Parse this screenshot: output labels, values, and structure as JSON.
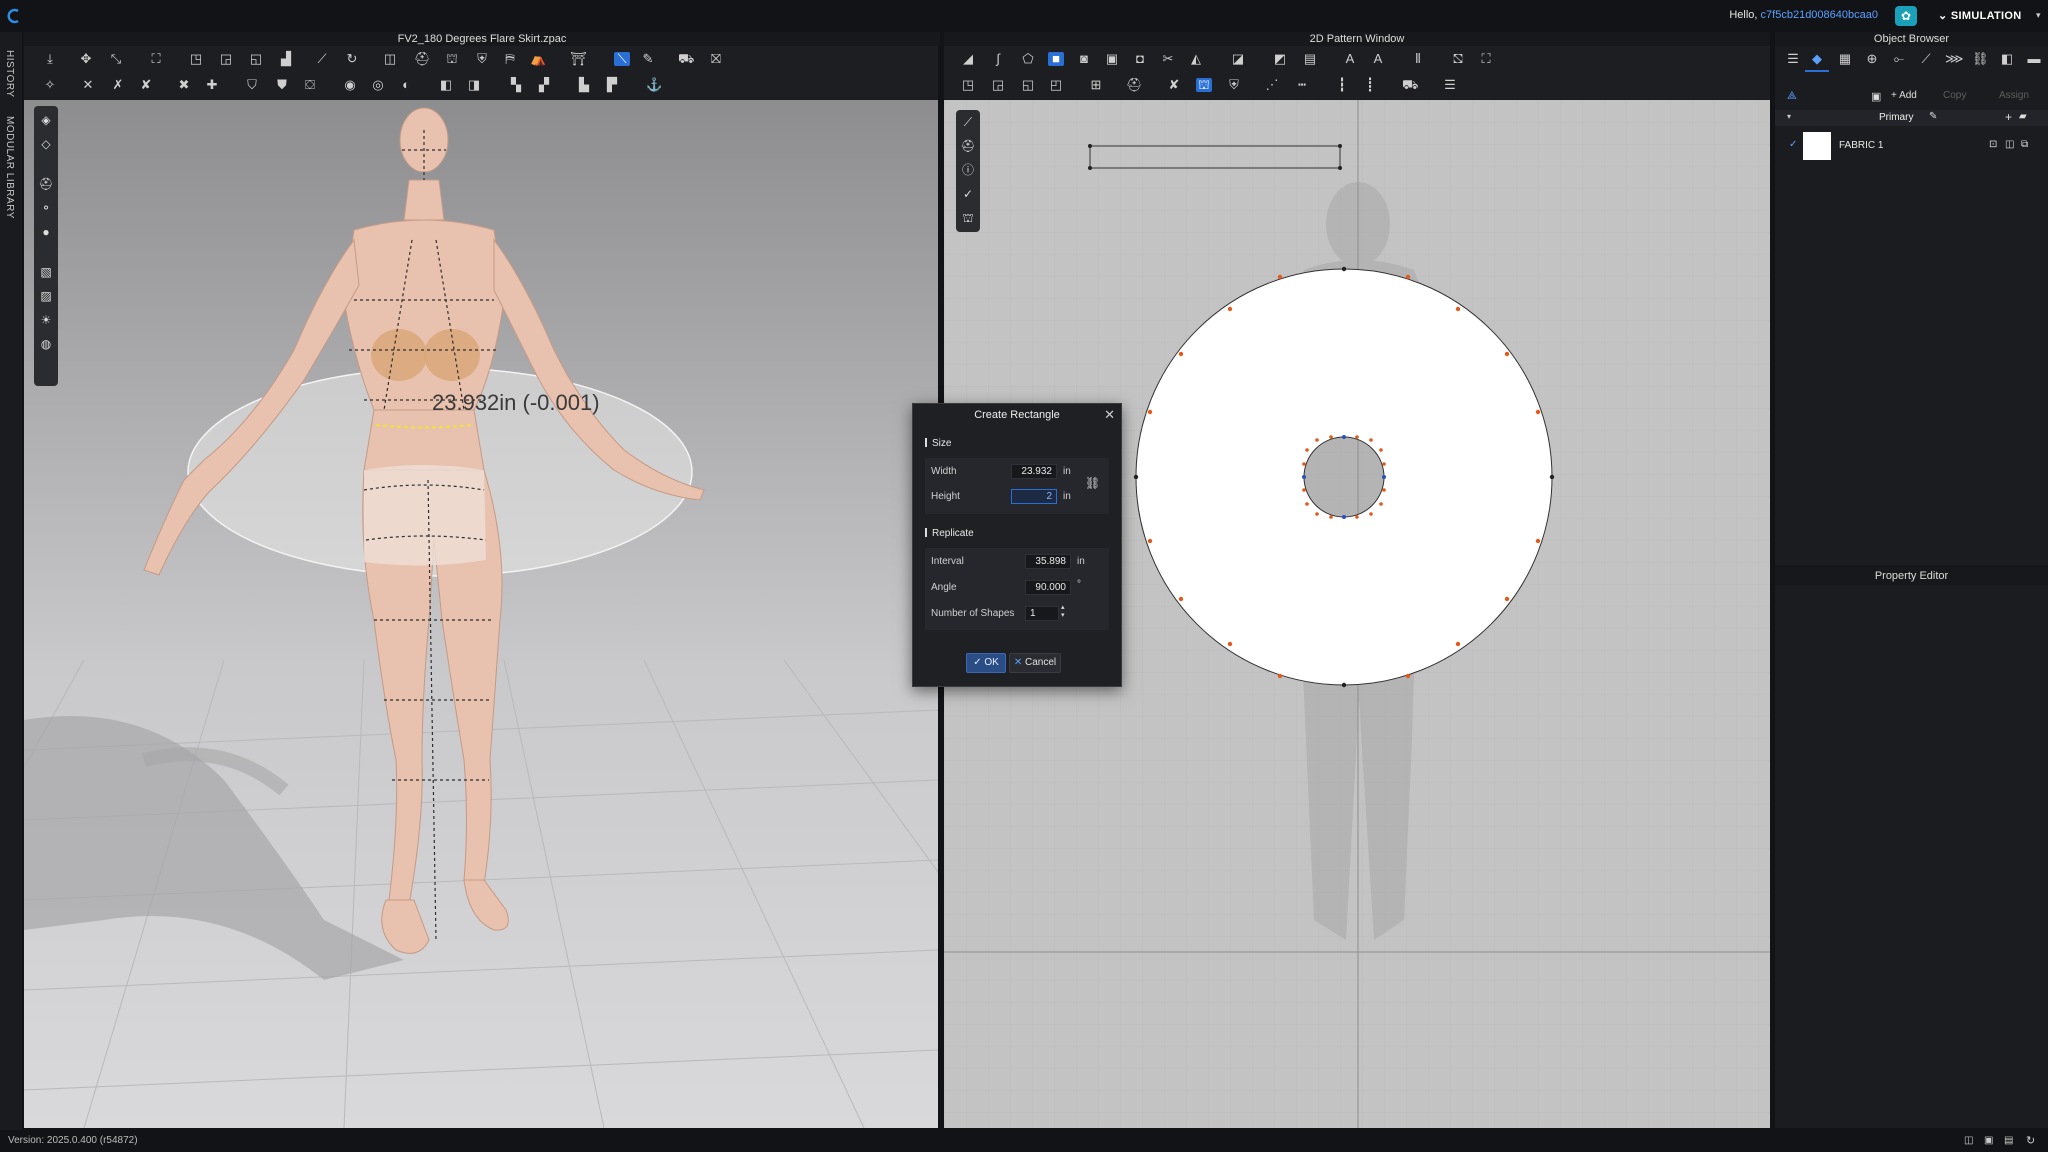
{
  "user": {
    "greeting": "Hello, ",
    "id": "c7f5cb21d008640bcaa0"
  },
  "mode": {
    "label": "SIMULATION"
  },
  "side_tabs": [
    "HISTORY",
    "MODULAR LIBRARY"
  ],
  "window_3d": {
    "title": "FV2_180 Degrees Flare Skirt.zpac",
    "measurement": "23.932in (-0.001)"
  },
  "window_2d": {
    "title": "2D Pattern Window"
  },
  "object_browser": {
    "title": "Object Browser",
    "add_label": "+ Add",
    "copy_label": "Copy",
    "assign_label": "Assign",
    "colorway": "Primary",
    "fabric_item": {
      "name": "FABRIC 1",
      "swatch_color": "#ffffff"
    }
  },
  "property_editor": {
    "title": "Property Editor"
  },
  "dialog": {
    "title": "Create Rectangle",
    "size_section": "Size",
    "width_label": "Width",
    "width_value": "23.932",
    "width_unit": "in",
    "height_label": "Height",
    "height_value": "2",
    "height_unit": "in",
    "replicate_section": "Replicate",
    "interval_label": "Interval",
    "interval_value": "35.898",
    "interval_unit": "in",
    "angle_label": "Angle",
    "angle_value": "90.000",
    "angle_unit": "°",
    "shapes_label": "Number of Shapes",
    "shapes_value": "1",
    "ok_label": "OK",
    "cancel_label": "Cancel"
  },
  "status": {
    "version": "Version: 2025.0.400 (r54872)"
  },
  "colors": {
    "accent": "#2a6fd6",
    "point_orange": "#e05a1c",
    "point_blue": "#2a4fc0",
    "panel": "#1b1c20"
  }
}
